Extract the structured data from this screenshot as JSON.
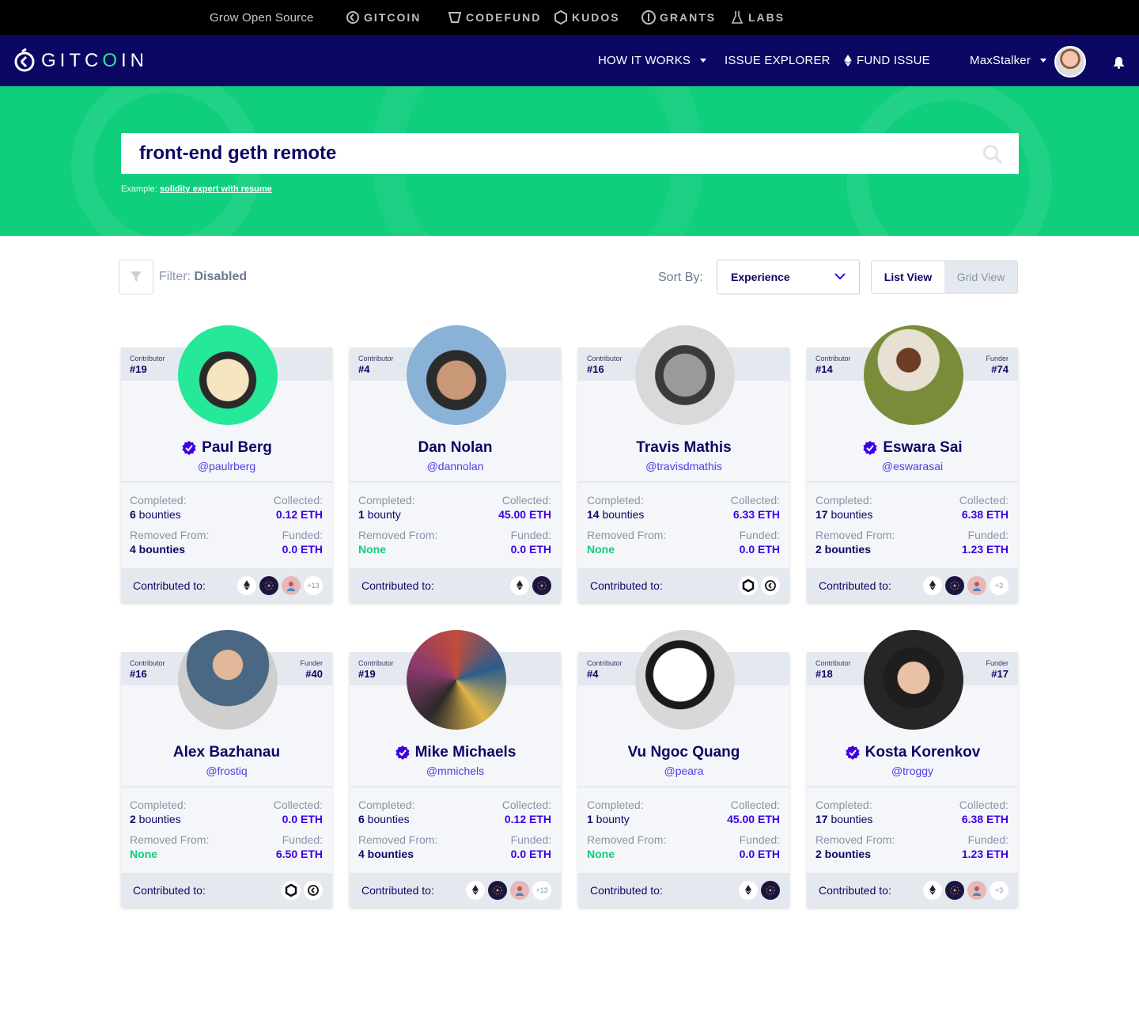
{
  "topbar": {
    "tagline": "Grow Open Source",
    "brands": [
      {
        "label": "GITCOIN",
        "icon": "gitcoin-icon"
      },
      {
        "label": "CODEFUND",
        "icon": "codefund-icon"
      },
      {
        "label": "KUDOS",
        "icon": "kudos-icon"
      },
      {
        "label": "GRANTS",
        "icon": "grants-icon"
      },
      {
        "label": "LABS",
        "icon": "labs-flask-icon"
      }
    ]
  },
  "navbar": {
    "logo_text_1": "GITC",
    "logo_text_o": "O",
    "logo_text_2": "IN",
    "how_it_works": "HOW IT WORKS",
    "issue_explorer": "ISSUE EXPLORER",
    "fund_issue": "FUND ISSUE",
    "username": "MaxStalker"
  },
  "search": {
    "query": "front-end geth remote",
    "example_prefix": "Example:",
    "example_link": "solidity expert with resume"
  },
  "toolbar": {
    "filter_prefix": "Filter:",
    "filter_value": "Disabled",
    "sort_label": "Sort By:",
    "sort_value": "Experience",
    "list_view": "List View",
    "grid_view": "Grid View"
  },
  "labels": {
    "completed": "Completed:",
    "collected": "Collected:",
    "removed_from": "Removed From:",
    "funded": "Funded:",
    "contributed_to": "Contributed to:",
    "contributor": "Contributor",
    "funder": "Funder"
  },
  "cards": [
    {
      "contributor_rank": "#19",
      "funder_rank": "",
      "name": "Paul Berg",
      "verified": true,
      "handle": "@paulrberg",
      "completed_num": "6",
      "completed_unit": " bounties",
      "collected": "0.12 ETH",
      "removed_num": "4 bounties",
      "removed_none": false,
      "funded": "0.0 ETH",
      "orgs": [
        "eth",
        "dark",
        "pink",
        "+13"
      ]
    },
    {
      "contributor_rank": "#4",
      "funder_rank": "",
      "name": "Dan Nolan",
      "verified": false,
      "handle": "@dannolan",
      "completed_num": "1",
      "completed_unit": " bounty",
      "collected": "45.00 ETH",
      "removed_num": "None",
      "removed_none": true,
      "funded": "0.0 ETH",
      "orgs": [
        "eth",
        "dark"
      ]
    },
    {
      "contributor_rank": "#16",
      "funder_rank": "",
      "name": "Travis Mathis",
      "verified": false,
      "handle": "@travisdmathis",
      "completed_num": "14",
      "completed_unit": " bounties",
      "collected": "6.33 ETH",
      "removed_num": "None",
      "removed_none": true,
      "funded": "0.0 ETH",
      "orgs": [
        "hex",
        "gitcoin"
      ]
    },
    {
      "contributor_rank": "#14",
      "funder_rank": "#74",
      "name": "Eswara Sai",
      "verified": true,
      "handle": "@eswarasai",
      "completed_num": "17",
      "completed_unit": " bounties",
      "collected": "6.38 ETH",
      "removed_num": "2 bounties",
      "removed_none": false,
      "funded": "1.23 ETH",
      "orgs": [
        "eth",
        "dark",
        "pink",
        "+3"
      ]
    },
    {
      "contributor_rank": "#16",
      "funder_rank": "#40",
      "name": "Alex Bazhanau",
      "verified": false,
      "handle": "@frostiq",
      "completed_num": "2",
      "completed_unit": " bounties",
      "collected": "0.0 ETH",
      "removed_num": "None",
      "removed_none": true,
      "funded": "6.50 ETH",
      "orgs": [
        "hex",
        "gitcoin"
      ]
    },
    {
      "contributor_rank": "#19",
      "funder_rank": "",
      "name": "Mike Michaels",
      "verified": true,
      "handle": "@mmichels",
      "completed_num": "6",
      "completed_unit": " bounties",
      "collected": "0.12 ETH",
      "removed_num": "4 bounties",
      "removed_none": false,
      "funded": "0.0 ETH",
      "orgs": [
        "eth",
        "dark",
        "pink",
        "+13"
      ]
    },
    {
      "contributor_rank": "#4",
      "funder_rank": "",
      "name": "Vu Ngoc Quang",
      "verified": false,
      "handle": "@peara",
      "completed_num": "1",
      "completed_unit": " bounty",
      "collected": "45.00 ETH",
      "removed_num": "None",
      "removed_none": true,
      "funded": "0.0 ETH",
      "orgs": [
        "eth",
        "dark"
      ]
    },
    {
      "contributor_rank": "#18",
      "funder_rank": "#17",
      "name": "Kosta Korenkov",
      "verified": true,
      "handle": "@troggy",
      "completed_num": "17",
      "completed_unit": " bounties",
      "collected": "6.38 ETH",
      "removed_num": "2 bounties",
      "removed_none": false,
      "funded": "1.23 ETH",
      "orgs": [
        "eth",
        "dark",
        "pink",
        "+3"
      ]
    }
  ],
  "colors": {
    "navy": "#0d0764",
    "green": "#0fce7c",
    "purple": "#3d00e6",
    "card_bg": "#f4f6f9",
    "card_head": "#e4e9f0"
  }
}
